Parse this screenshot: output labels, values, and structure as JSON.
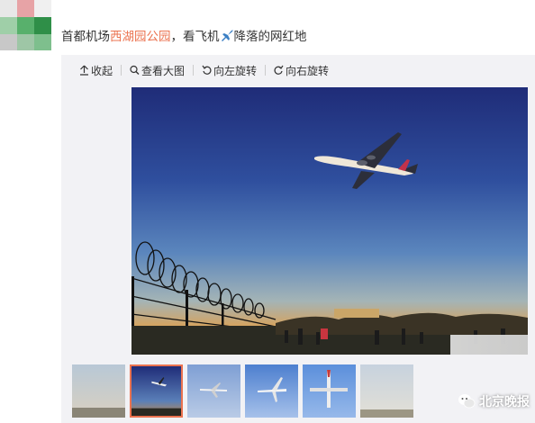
{
  "post": {
    "text_before": "首都机场",
    "link_text": "西湖园公园",
    "text_after_link": "，看飞机",
    "emoji_name": "airplane-emoji",
    "text_end": "降落的网红地"
  },
  "toolbar": {
    "collapse_label": "收起",
    "view_large_label": "查看大图",
    "rotate_left_label": "向左旋转",
    "rotate_right_label": "向右旋转"
  },
  "thumbnails": [
    {
      "name": "thumb-1",
      "active": false
    },
    {
      "name": "thumb-2",
      "active": true
    },
    {
      "name": "thumb-3",
      "active": false
    },
    {
      "name": "thumb-4",
      "active": false
    },
    {
      "name": "thumb-5",
      "active": false
    },
    {
      "name": "thumb-6",
      "active": false
    }
  ],
  "watermark": {
    "label": "北京晚报",
    "icon": "wechat-icon"
  },
  "colors": {
    "link": "#eb7350",
    "media_bg": "#f2f2f5",
    "sky_top": "#27337f",
    "sky_bottom": "#d99a4f"
  }
}
